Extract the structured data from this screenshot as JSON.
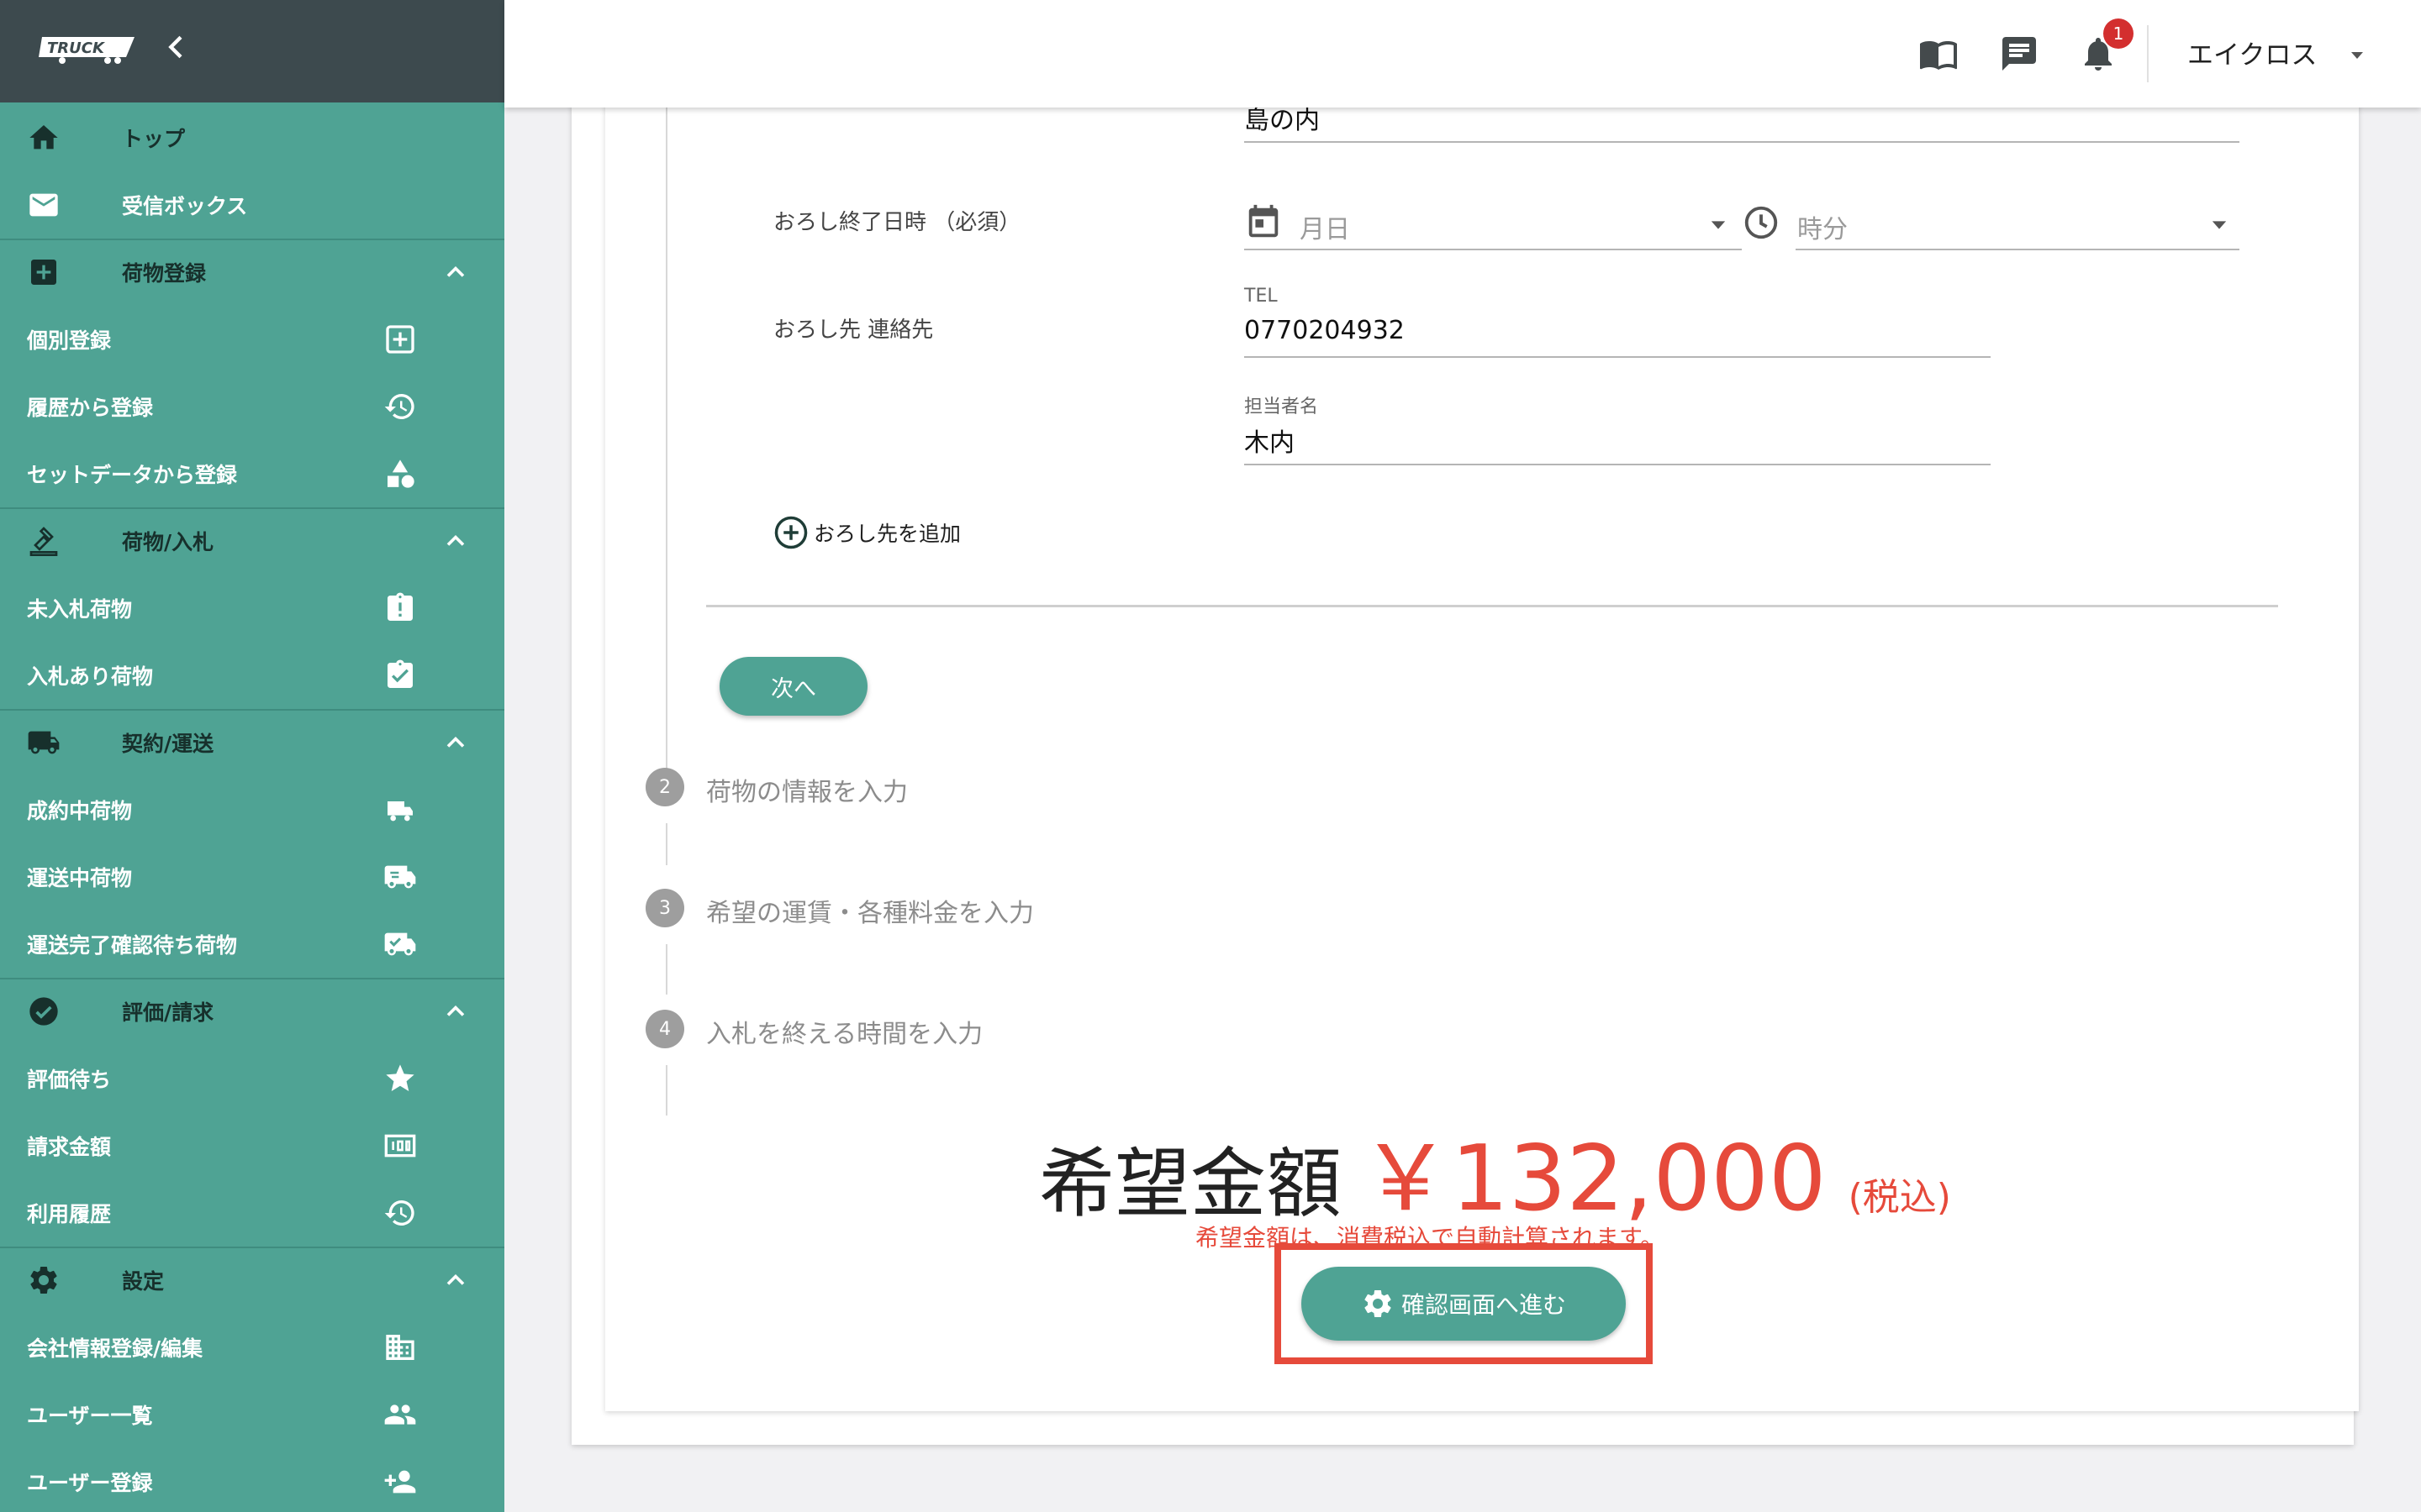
{
  "app": {
    "logo_text": "TRUCK"
  },
  "colors": {
    "accent": "#4fa394",
    "sidebar_top": "#3d4a4e",
    "price_red": "#e64a3b",
    "badge_red": "#d32f2f"
  },
  "sidebar": {
    "top": "トップ",
    "inbox": "受信ボックス",
    "cargo_register": {
      "label": "荷物登録",
      "items": [
        "個別登録",
        "履歴から登録",
        "セットデータから登録"
      ]
    },
    "cargo_bid": {
      "label": "荷物/入札",
      "items": [
        "未入札荷物",
        "入札あり荷物"
      ]
    },
    "contract": {
      "label": "契約/運送",
      "items": [
        "成約中荷物",
        "運送中荷物",
        "運送完了確認待ち荷物"
      ]
    },
    "evaluation": {
      "label": "評価/請求",
      "items": [
        "評価待ち",
        "請求金額",
        "利用履歴"
      ]
    },
    "settings": {
      "label": "設定",
      "items": [
        "会社情報登録/編集",
        "ユーザー一覧",
        "ユーザー登録"
      ]
    }
  },
  "topbar": {
    "notification_count": "1",
    "user_name": "エイクロス"
  },
  "form": {
    "address_value": "島の内",
    "end_datetime_label": "おろし終了日時 （必須）",
    "date_placeholder": "月日",
    "time_placeholder": "時分",
    "contact_label": "おろし先 連絡先",
    "tel_label": "TEL",
    "tel_value": "0770204932",
    "person_label": "担当者名",
    "person_value": "木内",
    "add_destination": "おろし先を追加",
    "next_button": "次へ"
  },
  "steps": [
    {
      "num": "2",
      "label": "荷物の情報を入力"
    },
    {
      "num": "3",
      "label": "希望の運賃・各種料金を入力"
    },
    {
      "num": "4",
      "label": "入札を終える時間を入力"
    }
  ],
  "price": {
    "label": "希望金額",
    "value": "￥132,000",
    "tax": "(税込)",
    "note": "希望金額は、消費税込で自動計算されます。"
  },
  "confirm_button": "確認画面へ進む"
}
